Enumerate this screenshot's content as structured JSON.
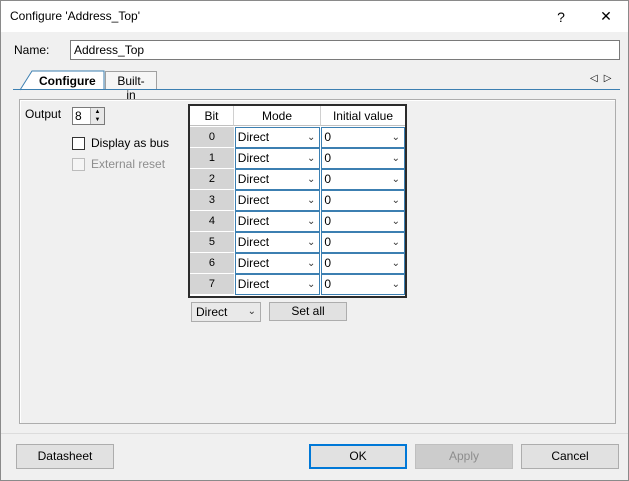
{
  "window": {
    "title": "Configure 'Address_Top'",
    "help_glyph": "?",
    "close_glyph": "✕"
  },
  "name": {
    "label": "Name:",
    "value": "Address_Top"
  },
  "tabs": [
    {
      "label": "Configure",
      "active": true
    },
    {
      "label": "Built-in",
      "active": false
    }
  ],
  "tab_scroll": {
    "left": "◁",
    "right": "▷"
  },
  "output": {
    "label": "Output",
    "value": "8"
  },
  "options": {
    "display_as_bus": {
      "label": "Display as bus",
      "checked": false,
      "enabled": true
    },
    "external_reset": {
      "label": "External reset",
      "checked": false,
      "enabled": false
    }
  },
  "table": {
    "headers": [
      "Bit",
      "Mode",
      "Initial value"
    ],
    "rows": [
      {
        "bit": "0",
        "mode": "Direct",
        "initial": "0"
      },
      {
        "bit": "1",
        "mode": "Direct",
        "initial": "0"
      },
      {
        "bit": "2",
        "mode": "Direct",
        "initial": "0"
      },
      {
        "bit": "3",
        "mode": "Direct",
        "initial": "0"
      },
      {
        "bit": "4",
        "mode": "Direct",
        "initial": "0"
      },
      {
        "bit": "5",
        "mode": "Direct",
        "initial": "0"
      },
      {
        "bit": "6",
        "mode": "Direct",
        "initial": "0"
      },
      {
        "bit": "7",
        "mode": "Direct",
        "initial": "0"
      }
    ]
  },
  "bulk": {
    "mode_value": "Direct",
    "set_all_label": "Set all"
  },
  "buttons": {
    "datasheet": "Datasheet",
    "ok": "OK",
    "apply": "Apply",
    "cancel": "Cancel"
  },
  "colors": {
    "accent": "#0078d7",
    "tab_border": "#3c7fb1",
    "bit_cell": "#d4d4d4"
  }
}
